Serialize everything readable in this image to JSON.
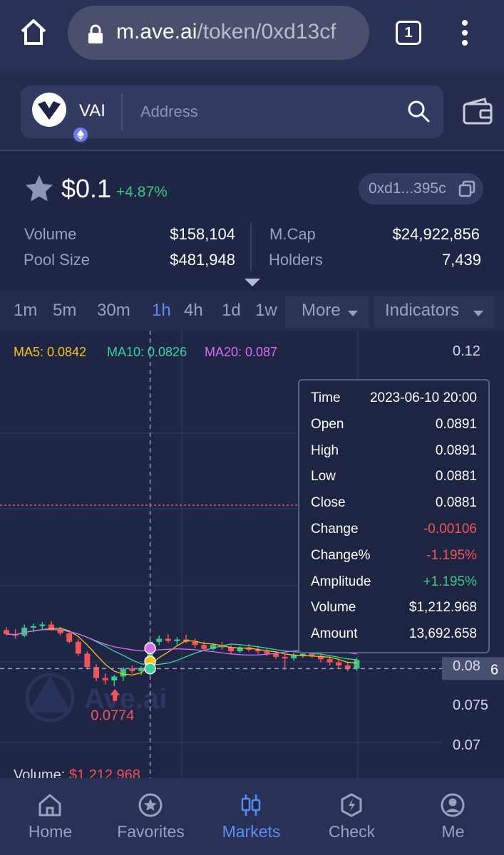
{
  "browser": {
    "url_host": "m.ave.ai",
    "url_path": "/token/0xd13cf",
    "tab_count": "1"
  },
  "search": {
    "token_symbol": "VAI",
    "placeholder": "Address"
  },
  "token": {
    "price": "$0.1",
    "change": "+4.87%",
    "address_short": "0xd1...395c"
  },
  "stats": {
    "volume_label": "Volume",
    "volume_value": "$158,104",
    "pool_label": "Pool Size",
    "pool_value": "$481,948",
    "mcap_label": "M.Cap",
    "mcap_value": "$24,922,856",
    "holders_label": "Holders",
    "holders_value": "7,439"
  },
  "intervals": [
    "1m",
    "5m",
    "30m",
    "1h",
    "4h",
    "1d",
    "1w"
  ],
  "active_interval": "1h",
  "more_label": "More",
  "indicators_label": "Indicators",
  "colors": {
    "up": "#3cc68a",
    "down": "#f0555a",
    "accent": "#5b8cf5",
    "ma5": "#f5c518",
    "ma10": "#39d3a0",
    "ma20": "#d96cf0"
  },
  "chart_data": {
    "type": "candlestick",
    "ma_legend": {
      "ma5": "MA5: 0.0842",
      "ma10": "MA10: 0.0826",
      "ma20": "MA20: 0.087"
    },
    "y_ticks": [
      "0.12",
      "0.08",
      "0.075",
      "0.07"
    ],
    "crosshair_value_fragment": "6",
    "low_marker": "0.0774",
    "volume_label": "Volume: ",
    "volume_value": "$1,212.968",
    "watermark": "Ave.ai",
    "candles": [
      {
        "o": 0.0845,
        "h": 0.0849,
        "l": 0.0838,
        "c": 0.084
      },
      {
        "o": 0.084,
        "h": 0.0846,
        "l": 0.0834,
        "c": 0.0838
      },
      {
        "o": 0.0838,
        "h": 0.0852,
        "l": 0.0836,
        "c": 0.0848
      },
      {
        "o": 0.0848,
        "h": 0.0853,
        "l": 0.0842,
        "c": 0.085
      },
      {
        "o": 0.085,
        "h": 0.0855,
        "l": 0.0846,
        "c": 0.0852
      },
      {
        "o": 0.0852,
        "h": 0.0856,
        "l": 0.0844,
        "c": 0.0846
      },
      {
        "o": 0.0846,
        "h": 0.0849,
        "l": 0.0838,
        "c": 0.0841
      },
      {
        "o": 0.0841,
        "h": 0.0845,
        "l": 0.0828,
        "c": 0.083
      },
      {
        "o": 0.083,
        "h": 0.0834,
        "l": 0.0812,
        "c": 0.0815
      },
      {
        "o": 0.0815,
        "h": 0.0818,
        "l": 0.0795,
        "c": 0.0798
      },
      {
        "o": 0.0798,
        "h": 0.0802,
        "l": 0.078,
        "c": 0.0784
      },
      {
        "o": 0.0784,
        "h": 0.079,
        "l": 0.0776,
        "c": 0.0781
      },
      {
        "o": 0.0781,
        "h": 0.0788,
        "l": 0.0774,
        "c": 0.0786
      },
      {
        "o": 0.0786,
        "h": 0.0798,
        "l": 0.078,
        "c": 0.0796
      },
      {
        "o": 0.0796,
        "h": 0.08,
        "l": 0.079,
        "c": 0.0793
      },
      {
        "o": 0.0793,
        "h": 0.0799,
        "l": 0.0788,
        "c": 0.0797
      },
      {
        "o": 0.0797,
        "h": 0.0833,
        "l": 0.0795,
        "c": 0.083
      },
      {
        "o": 0.083,
        "h": 0.0838,
        "l": 0.0826,
        "c": 0.0834
      },
      {
        "o": 0.0834,
        "h": 0.084,
        "l": 0.0829,
        "c": 0.0831
      },
      {
        "o": 0.0831,
        "h": 0.0836,
        "l": 0.0826,
        "c": 0.0833
      },
      {
        "o": 0.0833,
        "h": 0.0839,
        "l": 0.0828,
        "c": 0.083
      },
      {
        "o": 0.083,
        "h": 0.0834,
        "l": 0.0822,
        "c": 0.0826
      },
      {
        "o": 0.0826,
        "h": 0.083,
        "l": 0.0818,
        "c": 0.0821
      },
      {
        "o": 0.0821,
        "h": 0.0828,
        "l": 0.0819,
        "c": 0.0826
      },
      {
        "o": 0.0826,
        "h": 0.083,
        "l": 0.082,
        "c": 0.0823
      },
      {
        "o": 0.0823,
        "h": 0.0826,
        "l": 0.0814,
        "c": 0.0818
      },
      {
        "o": 0.0818,
        "h": 0.0825,
        "l": 0.0816,
        "c": 0.0823
      },
      {
        "o": 0.0823,
        "h": 0.0827,
        "l": 0.0818,
        "c": 0.082
      },
      {
        "o": 0.082,
        "h": 0.0824,
        "l": 0.0815,
        "c": 0.0818
      },
      {
        "o": 0.0818,
        "h": 0.0821,
        "l": 0.0812,
        "c": 0.0815
      },
      {
        "o": 0.0815,
        "h": 0.0818,
        "l": 0.0808,
        "c": 0.0811
      },
      {
        "o": 0.0811,
        "h": 0.0815,
        "l": 0.0795,
        "c": 0.0809
      },
      {
        "o": 0.0809,
        "h": 0.0816,
        "l": 0.0806,
        "c": 0.0813
      },
      {
        "o": 0.0813,
        "h": 0.0818,
        "l": 0.081,
        "c": 0.0815
      },
      {
        "o": 0.0815,
        "h": 0.0819,
        "l": 0.081,
        "c": 0.0812
      },
      {
        "o": 0.0812,
        "h": 0.0816,
        "l": 0.0804,
        "c": 0.0808
      },
      {
        "o": 0.0808,
        "h": 0.0812,
        "l": 0.08,
        "c": 0.0804
      },
      {
        "o": 0.0804,
        "h": 0.0808,
        "l": 0.0796,
        "c": 0.08
      },
      {
        "o": 0.08,
        "h": 0.0804,
        "l": 0.0793,
        "c": 0.0796
      },
      {
        "o": 0.0796,
        "h": 0.081,
        "l": 0.0793,
        "c": 0.0807
      }
    ]
  },
  "tooltip": [
    {
      "label": "Time",
      "value": "2023-06-10 20:00",
      "tone": "neutral"
    },
    {
      "label": "Open",
      "value": "0.0891",
      "tone": "neutral"
    },
    {
      "label": "High",
      "value": "0.0891",
      "tone": "neutral"
    },
    {
      "label": "Low",
      "value": "0.0881",
      "tone": "neutral"
    },
    {
      "label": "Close",
      "value": "0.0881",
      "tone": "neutral"
    },
    {
      "label": "Change",
      "value": "-0.00106",
      "tone": "down"
    },
    {
      "label": "Change%",
      "value": "-1.195%",
      "tone": "down"
    },
    {
      "label": "Amplitude",
      "value": "+1.195%",
      "tone": "up"
    },
    {
      "label": "Volume",
      "value": "$1,212.968",
      "tone": "neutral"
    },
    {
      "label": "Amount",
      "value": "13,692.658",
      "tone": "neutral"
    }
  ],
  "nav": [
    {
      "label": "Home",
      "icon": "home-icon"
    },
    {
      "label": "Favorites",
      "icon": "favorites-icon"
    },
    {
      "label": "Markets",
      "icon": "markets-icon"
    },
    {
      "label": "Check",
      "icon": "check-icon"
    },
    {
      "label": "Me",
      "icon": "me-icon"
    }
  ],
  "active_nav": "Markets"
}
